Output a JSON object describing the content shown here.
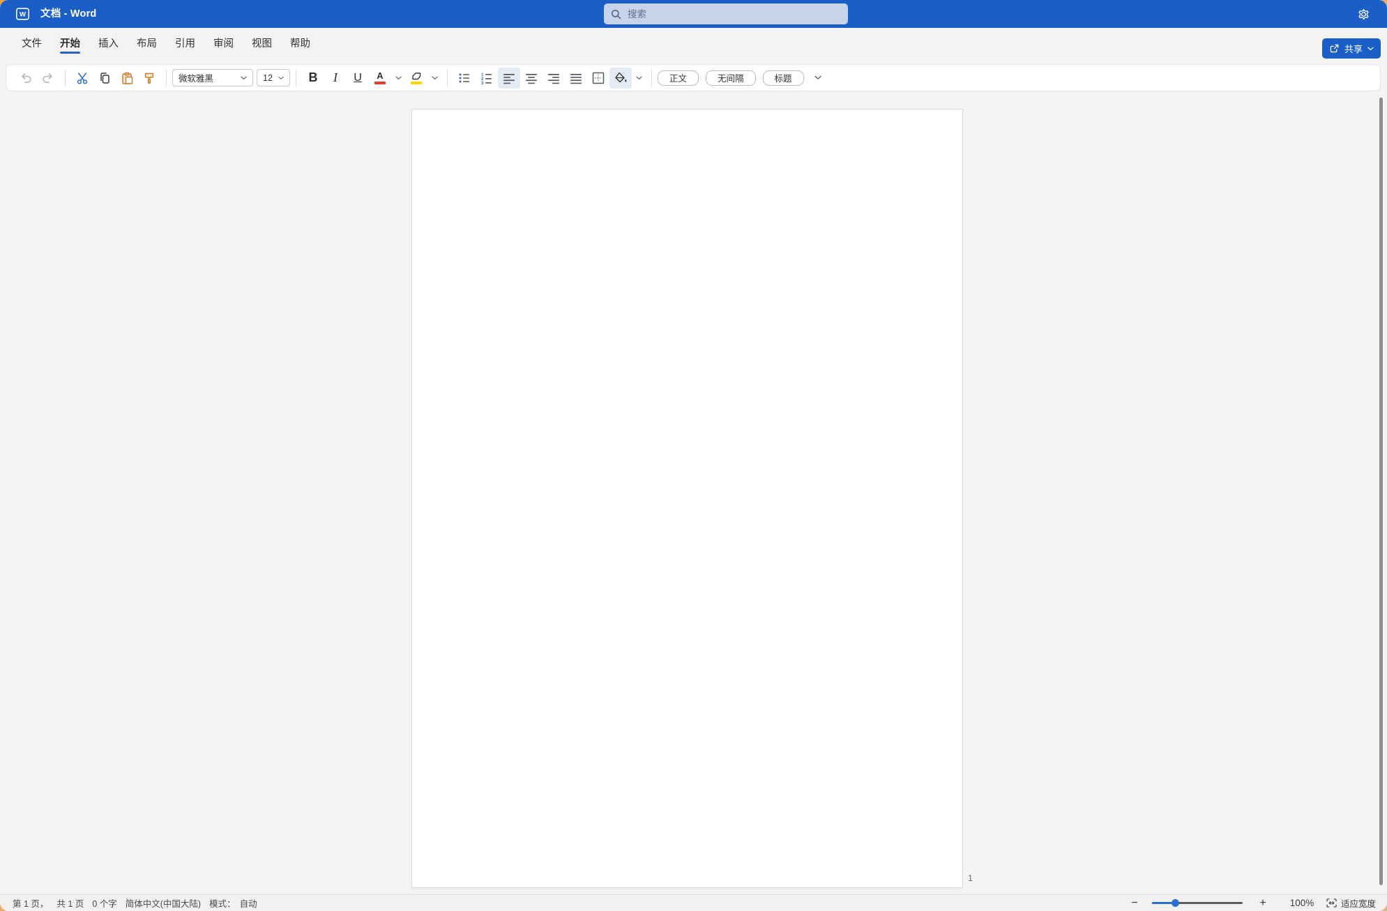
{
  "window": {
    "title": "文档 - Word"
  },
  "titlebar": {
    "search": {
      "placeholder": "搜索"
    }
  },
  "ribbon": {
    "tabs": [
      {
        "label": "文件"
      },
      {
        "label": "开始"
      },
      {
        "label": "插入"
      },
      {
        "label": "布局"
      },
      {
        "label": "引用"
      },
      {
        "label": "审阅"
      },
      {
        "label": "视图"
      },
      {
        "label": "帮助"
      }
    ],
    "active_tab": "开始",
    "share_label": "共享"
  },
  "toolbar": {
    "font_name": "微软雅黑",
    "font_size": "12",
    "bold_label": "B",
    "italic_label": "I",
    "underline_label": "U",
    "styles": [
      {
        "label": "正文"
      },
      {
        "label": "无间隔"
      },
      {
        "label": "标题"
      }
    ]
  },
  "document": {
    "page_number": "1"
  },
  "statusbar": {
    "page_position": "第 1 页，",
    "page_total": "共 1 页",
    "word_count": "0 个字",
    "language": "简体中文(中国大陆)",
    "mode_label": "模式：",
    "mode_value": "自动",
    "zoom_level": "100%",
    "fit_width_label": "适应宽度"
  },
  "colors": {
    "titlebar_blue": "#1b5ec7",
    "accent_blue": "#2e6ec0",
    "active_item_bg": "#e4ebf7",
    "font_color_red": "#e03c31",
    "highlight_yellow": "#ffd400",
    "clipboard_orange": "#c87e30"
  }
}
